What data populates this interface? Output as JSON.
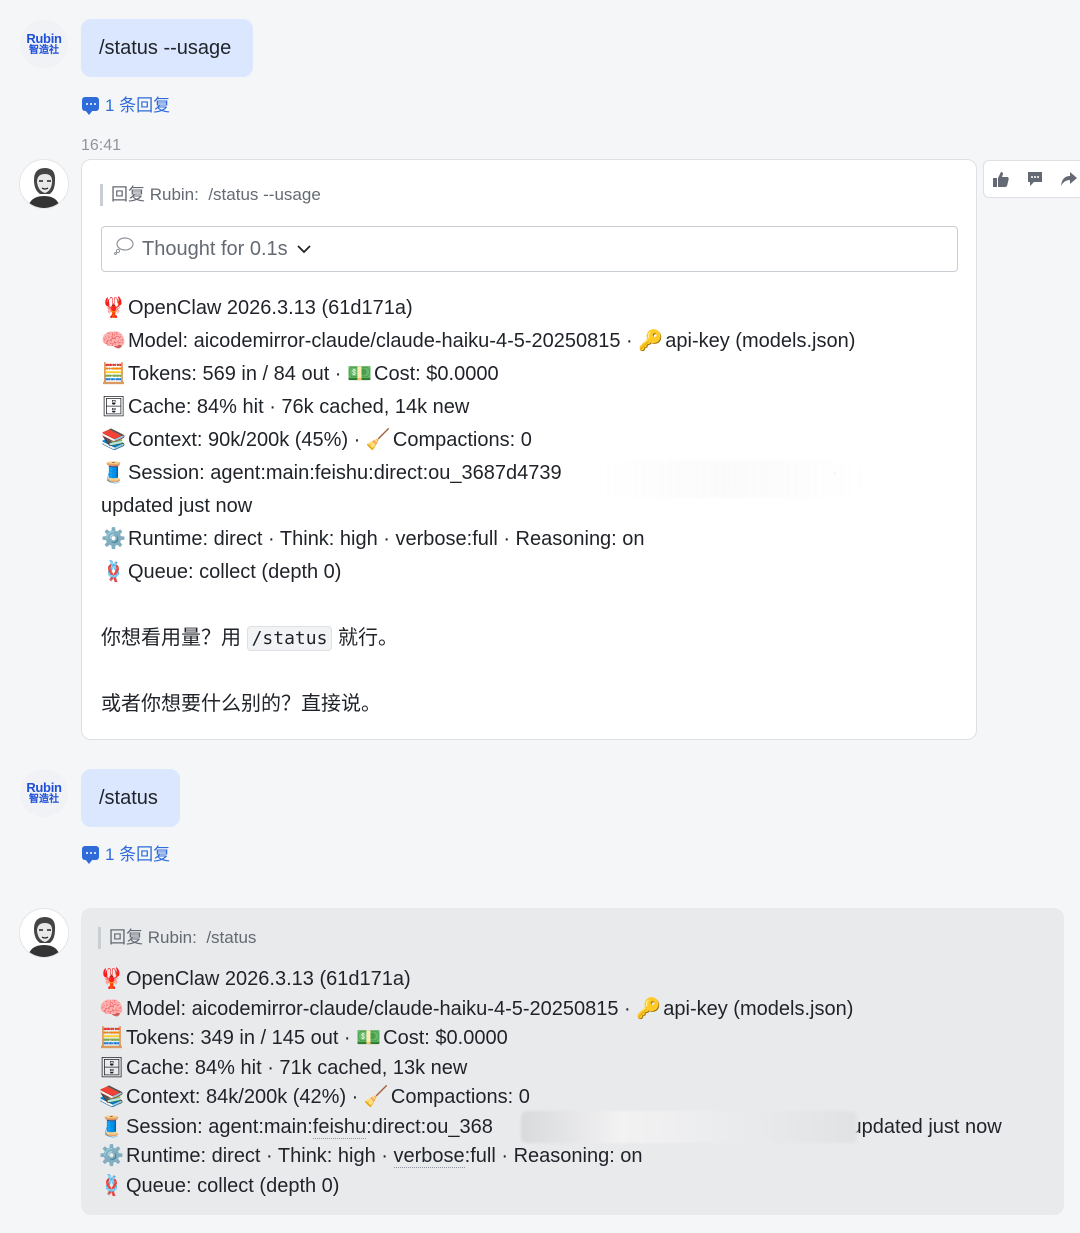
{
  "messages": {
    "m1": {
      "avatar": {
        "line1": "Rubin",
        "line2": "智造社"
      },
      "text": "/status --usage",
      "reply_count": "1 条回复"
    },
    "timestamp": "16:41",
    "m2": {
      "quote_prefix": "回复 Rubin:",
      "quote_text": "/status --usage",
      "thought": "Thought for 0.1s",
      "lines": {
        "l1": "OpenClaw 2026.3.13 (61d171a)",
        "l2": "Model: aicodemirror-claude/claude-haiku-4-5-20250815 ·",
        "l2b": "api-key (models.json)",
        "l3": "Tokens: 569 in / 84 out ·",
        "l3b": "Cost: $0.0000",
        "l4": "Cache: 84% hit · 76k cached, 14k new",
        "l5": "Context: 90k/200k (45%) ·",
        "l5b": "Compactions: 0",
        "l6": "Session: agent:main:feishu:direct:ou_3687d4739",
        "l6b": "·",
        "l6c": "updated just now",
        "l7": "Runtime: direct · Think: high · verbose:full · Reasoning: on",
        "l8": "Queue: collect (depth 0)"
      },
      "para1_before": "你想看用量？用",
      "para1_code": "/status",
      "para1_after": "就行。",
      "para2": "或者你想要什么别的？直接说。"
    },
    "m3": {
      "avatar": {
        "line1": "Rubin",
        "line2": "智造社"
      },
      "text": "/status",
      "reply_count": "1 条回复"
    },
    "m4": {
      "quote_prefix": "回复 Rubin:",
      "quote_text": "/status",
      "lines": {
        "l1": "OpenClaw 2026.3.13 (61d171a)",
        "l2": "Model: aicodemirror-claude/claude-haiku-4-5-20250815 ·",
        "l2b": "api-key (models.json)",
        "l3": "Tokens: 349 in / 145 out ·",
        "l3b": "Cost: $0.0000",
        "l4": "Cache: 84% hit · 71k cached, 13k new",
        "l5": "Context: 84k/200k (42%) ·",
        "l5b": "Compactions: 0",
        "l6a": "Session: agent:main:",
        "l6b": "feishu",
        "l6c": ":direct:ou_368",
        "l6d": "• updated just now",
        "l7a": "Runtime: direct · Think: high ·",
        "l7b": "verbose",
        "l7c": ":full · Reasoning: on",
        "l8": "Queue: collect (depth 0)"
      }
    }
  },
  "icons": [
    "reply-thread-icon",
    "thumbs-up-icon",
    "comment-icon",
    "forward-icon",
    "chevron-down-icon",
    "thought-bubble-icon",
    "lobster-icon",
    "brain-icon",
    "key-icon",
    "abacus-icon",
    "money-icon",
    "cabinet-icon",
    "books-icon",
    "broom-icon",
    "thread-spool-icon",
    "gear-icon",
    "queue-icon"
  ],
  "colors": {
    "accent": "#2f6bd9",
    "user_bubble": "#dbe7ff",
    "bot_grey_bubble": "#e9eaec"
  }
}
